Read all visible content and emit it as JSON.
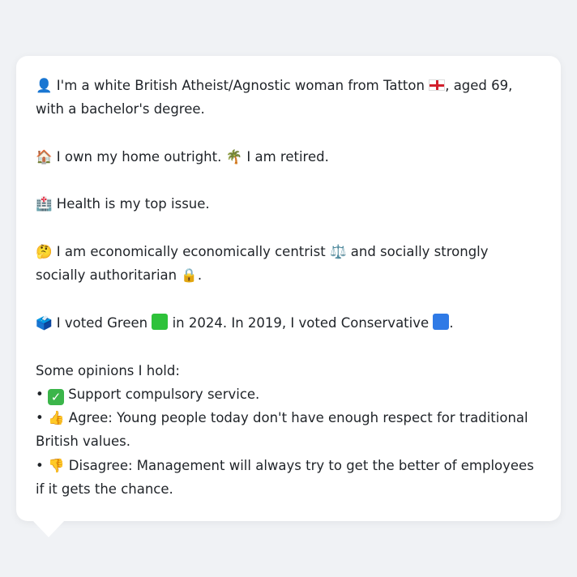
{
  "message": {
    "intro_icon": "👤",
    "intro_before_flag": "I'm a white British Atheist/Agnostic woman from Tatton",
    "intro_flag_icon": "england-flag-icon",
    "intro_after_flag": ", aged 69, with a bachelor's degree.",
    "home_icon": "🏠",
    "home_text": "I own my home outright.",
    "retired_icon": "🌴",
    "retired_text": "I am retired.",
    "health_icon": "🏥",
    "health_text": "Health is my top issue.",
    "politics_icon": "🤔",
    "politics_before": "I am economically economically centrist",
    "balance_icon": "⚖️",
    "politics_middle": "and socially strongly socially authoritarian",
    "lock_icon": "🔒",
    "politics_end": ".",
    "vote_icon": "🗳️",
    "vote_2024_before": "I voted Green",
    "vote_2024_after": "in 2024. In 2019, I voted Conservative",
    "vote_2019_end": ".",
    "green_color": "#2ec23a",
    "blue_color": "#2f7ae6",
    "opinions_heading": "Some opinions I hold:",
    "bullet": "•",
    "opinion1_icon": "check-mark-icon",
    "opinion1_text": "Support compulsory service.",
    "opinion2_icon": "👍",
    "opinion2_text": "Agree: Young people today don't have enough respect for traditional British values.",
    "opinion3_icon": "👎",
    "opinion3_text": "Disagree: Management will always try to get the better of employees if it gets the chance."
  }
}
